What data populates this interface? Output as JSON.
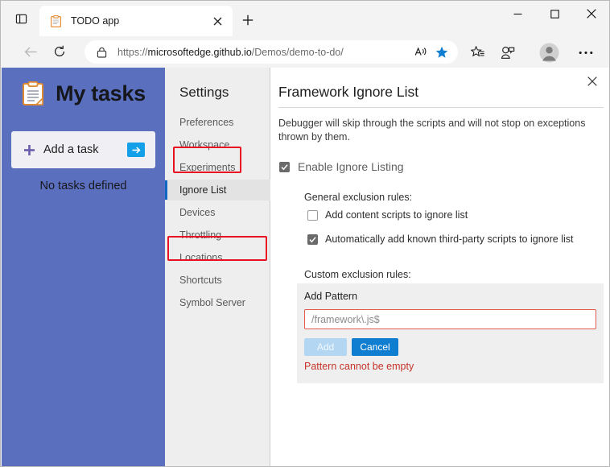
{
  "browser": {
    "tab": {
      "title": "TODO app",
      "favicon": "clipboard-icon",
      "close_icon": "close-icon"
    },
    "tab_search_icon": "tab-search-icon",
    "new_tab_icon": "plus-icon",
    "window_controls": {
      "minimize": "minimize-icon",
      "maximize": "maximize-icon",
      "close": "close-icon"
    },
    "nav": {
      "back_icon": "back-arrow-icon",
      "reload_icon": "reload-icon"
    },
    "omnibox": {
      "lock_icon": "lock-icon",
      "url_scheme": "https://",
      "url_host": "microsoftedge.github.io",
      "url_path": "/Demos/demo-to-do/",
      "read_aloud_icon": "read-aloud-icon",
      "favorite_icon": "star-filled-icon"
    },
    "toolbar": {
      "collections_icon": "collections-star-icon",
      "browser_essentials_icon": "browser-essentials-icon",
      "profile_icon": "profile-avatar-icon",
      "more_icon": "more-ellipsis-icon"
    }
  },
  "todo_app": {
    "icon": "clipboard-icon",
    "title": "My tasks",
    "add_task": {
      "plus_icon": "plus-icon",
      "label": "Add a task",
      "submit_icon": "arrow-right-icon"
    },
    "empty_message": "No tasks defined",
    "background_color": "#5b6fbf"
  },
  "devtools_settings": {
    "nav": {
      "title": "Settings",
      "items": [
        {
          "label": "Preferences",
          "selected": false
        },
        {
          "label": "Workspace",
          "selected": false
        },
        {
          "label": "Experiments",
          "selected": false
        },
        {
          "label": "Ignore List",
          "selected": true
        },
        {
          "label": "Devices",
          "selected": false
        },
        {
          "label": "Throttling",
          "selected": false
        },
        {
          "label": "Locations",
          "selected": false
        },
        {
          "label": "Shortcuts",
          "selected": false
        },
        {
          "label": "Symbol Server",
          "selected": false
        }
      ],
      "selected_accent_color": "#1168c4"
    },
    "pane": {
      "close_icon": "close-icon",
      "title": "Framework Ignore List",
      "description": "Debugger will skip through the scripts and will not stop on exceptions thrown by them.",
      "enable_checkbox": {
        "label": "Enable Ignore Listing",
        "checked": true
      },
      "general_rules_label": "General exclusion rules:",
      "general_rules": [
        {
          "label": "Add content scripts to ignore list",
          "checked": false
        },
        {
          "label": "Automatically add known third-party scripts to ignore list",
          "checked": true
        }
      ],
      "custom_rules_label": "Custom exclusion rules:",
      "add_pattern": {
        "label": "Add Pattern",
        "value": "",
        "placeholder": "/framework\\.js$",
        "add_button": "Add",
        "cancel_button": "Cancel",
        "error_message": "Pattern cannot be empty",
        "error_color": "#c5332a",
        "input_border_color": "#e05a50",
        "cancel_button_color": "#0f7ed1"
      }
    }
  },
  "annotations": {
    "highlight_color": "#e81123",
    "boxes": [
      {
        "target": "settings-nav-title"
      },
      {
        "target": "nav-item-ignore-list"
      }
    ]
  }
}
